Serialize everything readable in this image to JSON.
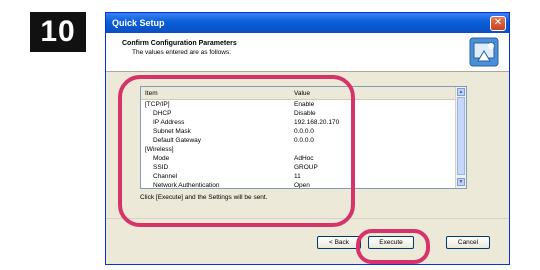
{
  "step": "10",
  "window": {
    "title": "Quick Setup",
    "close_glyph": "✕"
  },
  "header": {
    "title": "Confirm Configuration Parameters",
    "subtitle": "The values entered are as follows:"
  },
  "table": {
    "headers": [
      "Item",
      "Value"
    ],
    "rows": [
      {
        "item": "[TCP/IP]",
        "value": "Enable",
        "indent": false
      },
      {
        "item": "DHCP",
        "value": "Disable",
        "indent": true
      },
      {
        "item": "IP Address",
        "value": "192.168.20.170",
        "indent": true
      },
      {
        "item": "Subnet Mask",
        "value": "0.0.0.0",
        "indent": true
      },
      {
        "item": "Default Gateway",
        "value": "0.0.0.0",
        "indent": true
      },
      {
        "item": "[Wireless]",
        "value": "",
        "indent": false
      },
      {
        "item": "Mode",
        "value": "AdHoc",
        "indent": true
      },
      {
        "item": "SSID",
        "value": "GROUP",
        "indent": true
      },
      {
        "item": "Channel",
        "value": "11",
        "indent": true
      },
      {
        "item": "Network Authentication",
        "value": "Open",
        "indent": true
      }
    ]
  },
  "hint": "Click [Execute] and the Settings will be sent.",
  "buttons": {
    "back": "< Back",
    "execute": "Execute",
    "cancel": "Cancel"
  },
  "colors": {
    "highlight": "#d6336b",
    "titlebar": "#0a5ed7"
  }
}
